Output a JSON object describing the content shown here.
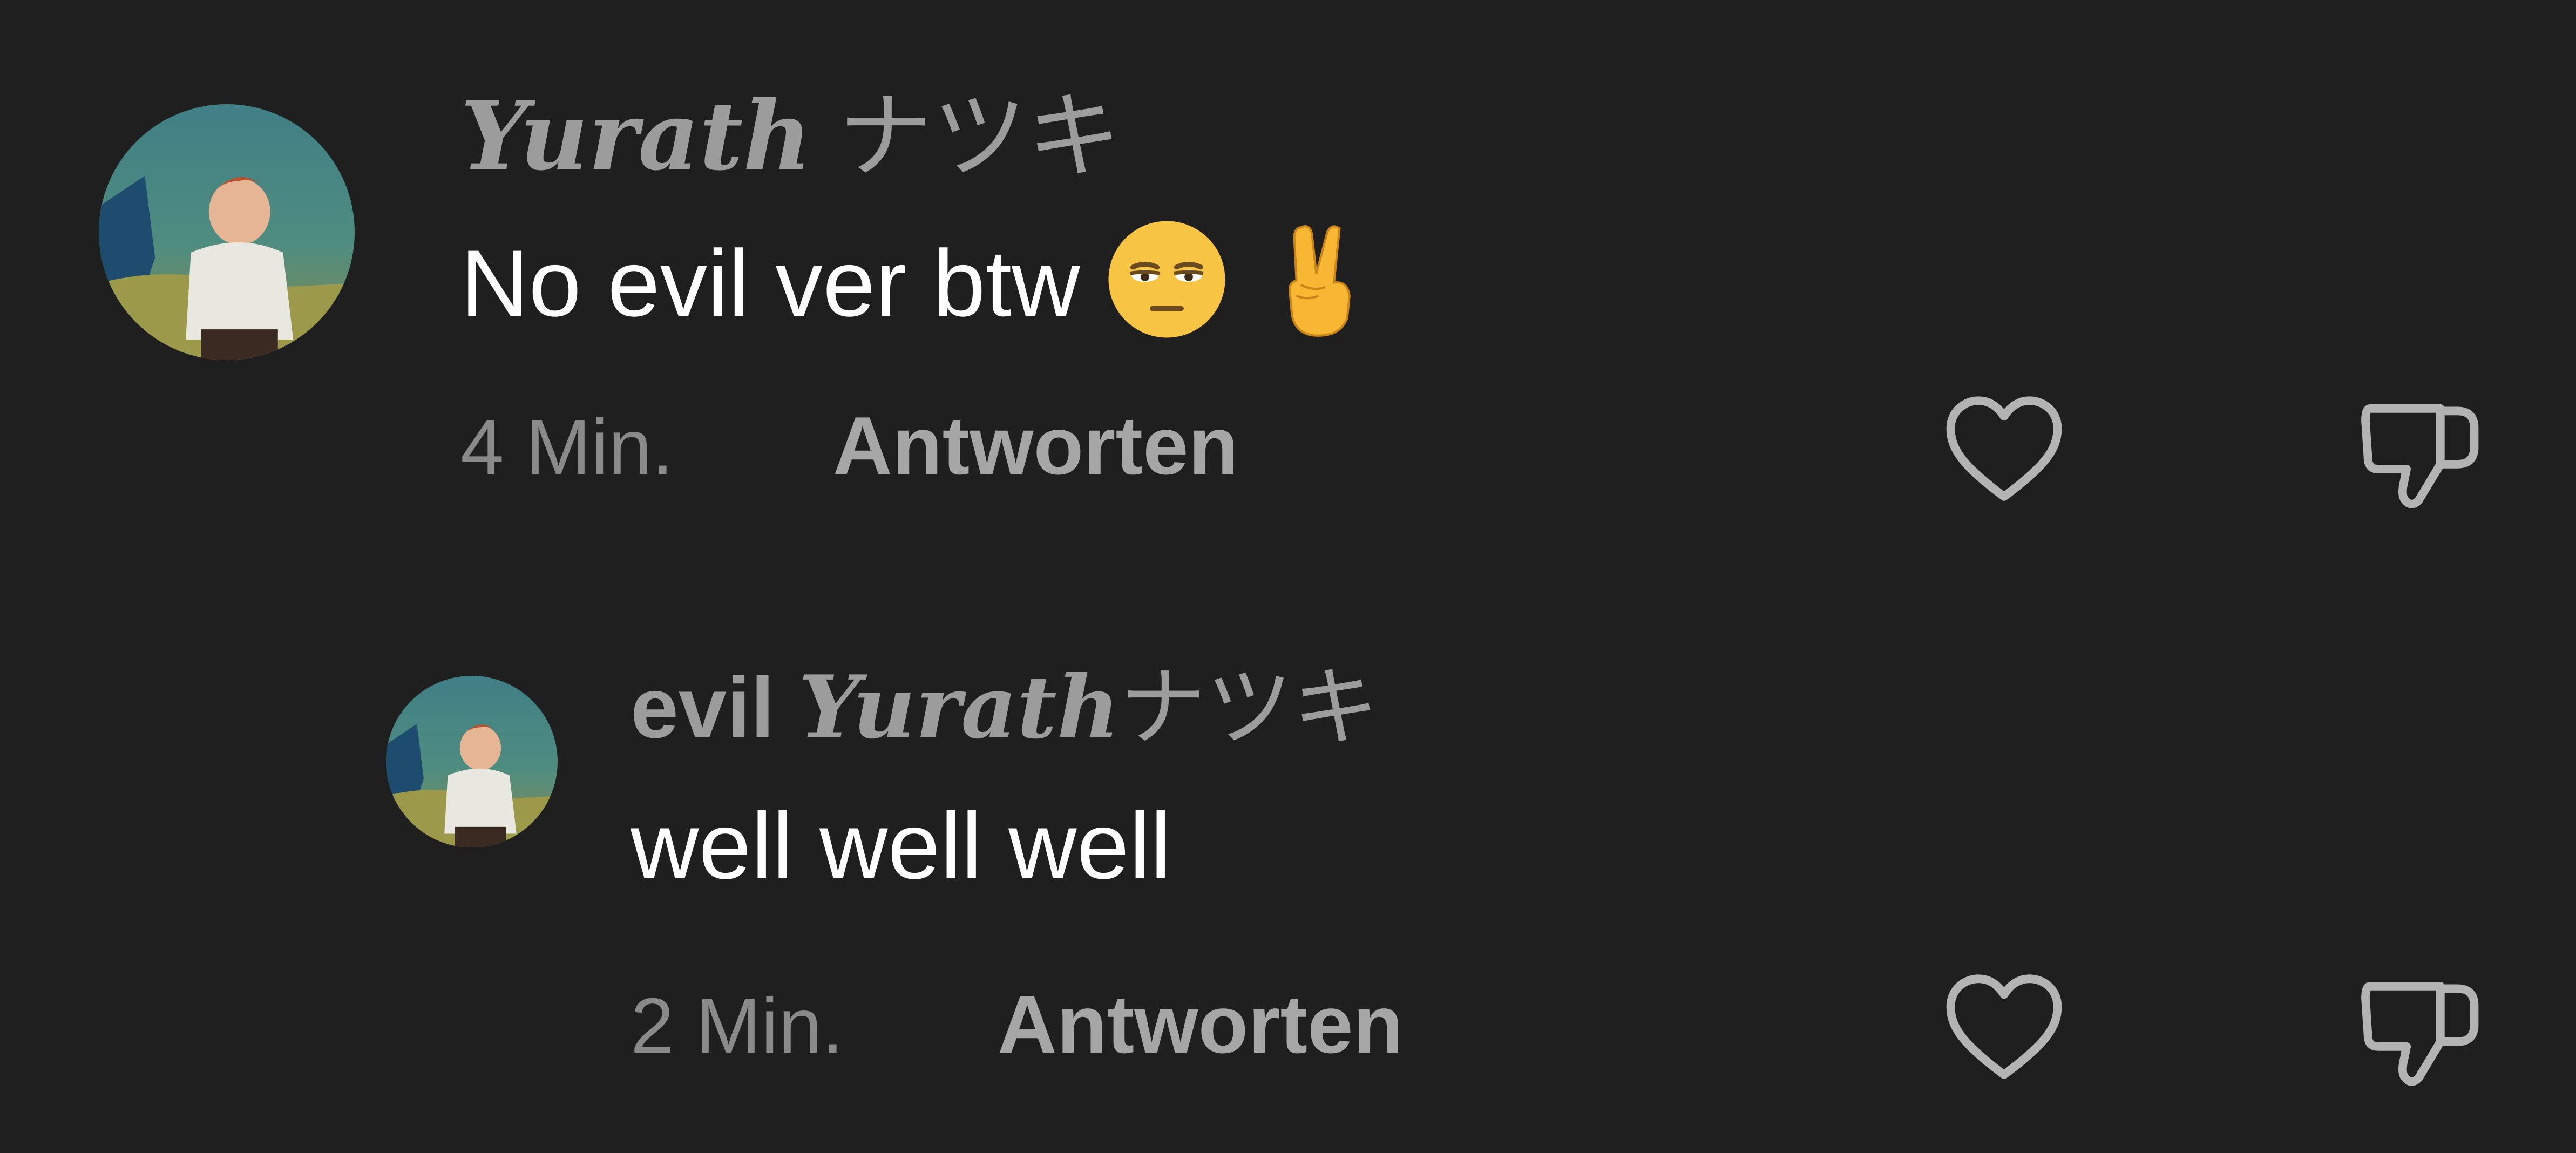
{
  "comments": [
    {
      "username_script": "Yurath",
      "username_suffix": "ナツキ",
      "text": "No evil ver btw",
      "emojis": [
        "relieved-face-emoji",
        "victory-hand-emoji"
      ],
      "time": "4 Min.",
      "reply_label": "Antworten",
      "icons": {
        "like": "heart-icon",
        "dislike": "thumbs-down-icon"
      }
    },
    {
      "username_prefix": "evil",
      "username_script": "Yurath",
      "username_suffix": "ナツキ",
      "text": "well well well",
      "time": "2 Min.",
      "reply_label": "Antworten",
      "icons": {
        "like": "heart-icon",
        "dislike": "thumbs-down-icon"
      }
    }
  ],
  "colors": {
    "background": "#1f1f1f",
    "username": "#9c9c9c",
    "comment_text": "#ffffff",
    "meta_text": "#8a8a8a",
    "action_icon": "#b3b3b3"
  }
}
